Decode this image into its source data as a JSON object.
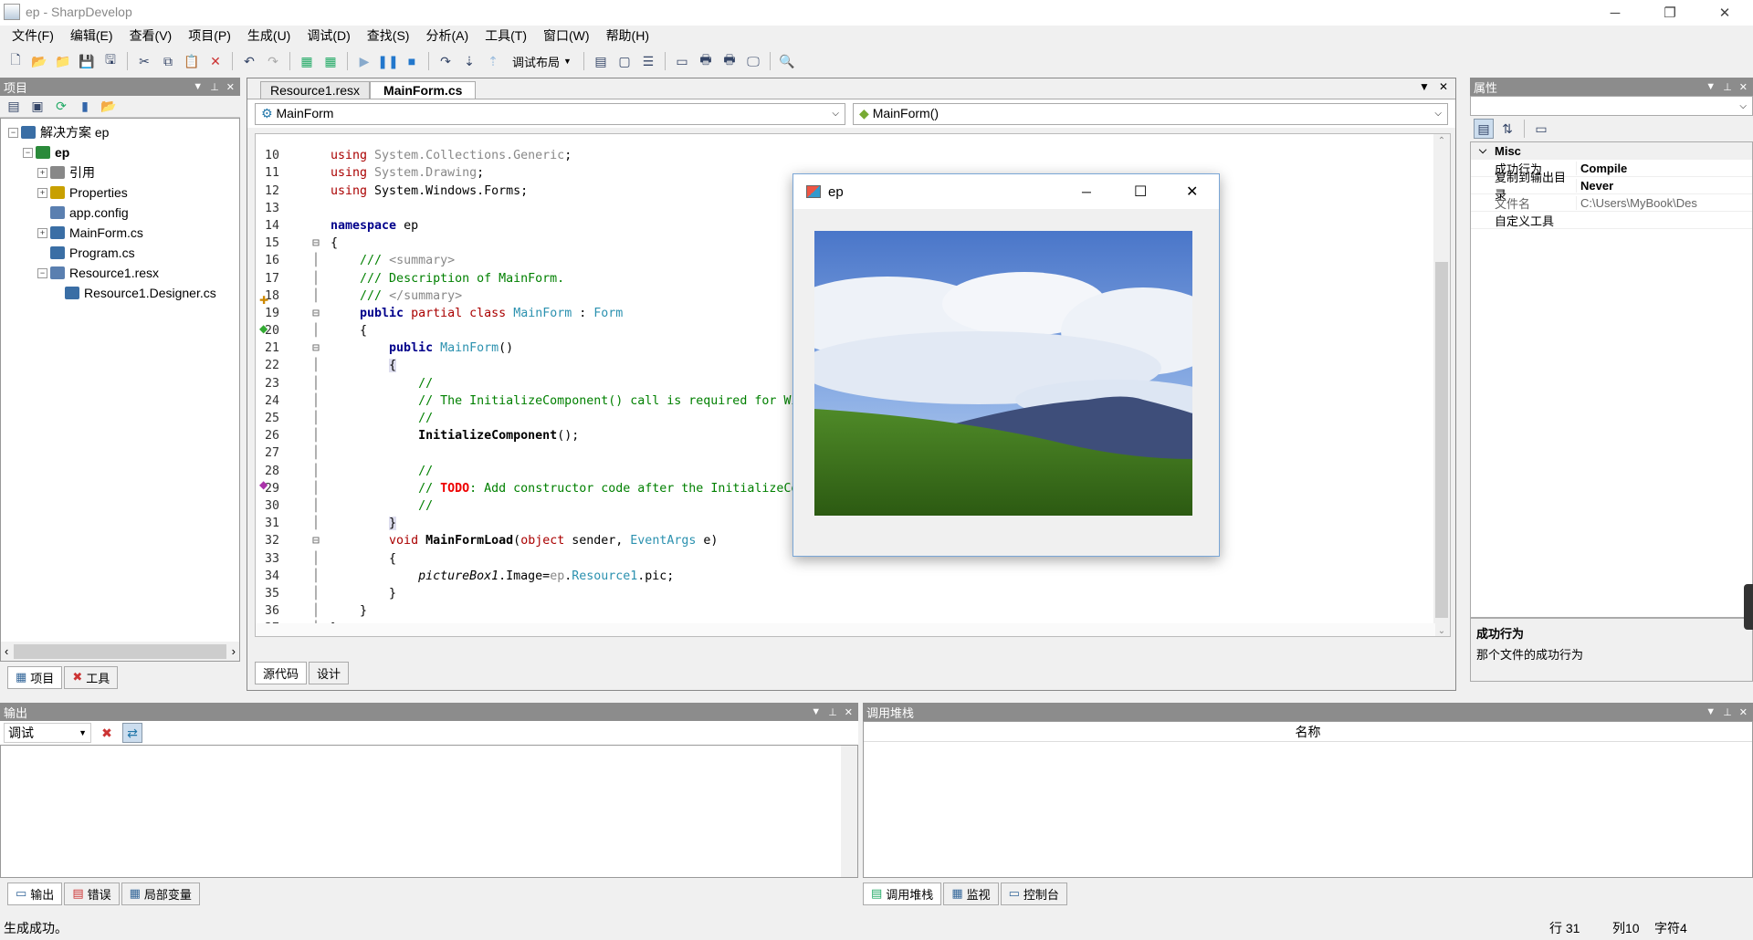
{
  "window": {
    "title": "ep - SharpDevelop",
    "min": "─",
    "max": "❐",
    "close": "✕"
  },
  "menu": [
    "文件(F)",
    "编辑(E)",
    "查看(V)",
    "项目(P)",
    "生成(U)",
    "调试(D)",
    "查找(S)",
    "分析(A)",
    "工具(T)",
    "窗口(W)",
    "帮助(H)"
  ],
  "toolbar": {
    "layout_label": "调试布局"
  },
  "project": {
    "title": "项目",
    "tree": [
      {
        "label": "解决方案 ep",
        "indent": 0,
        "exp": "−"
      },
      {
        "label": "ep",
        "indent": 1,
        "exp": "−",
        "bold": true
      },
      {
        "label": "引用",
        "indent": 2,
        "exp": "+"
      },
      {
        "label": "Properties",
        "indent": 2,
        "exp": "+"
      },
      {
        "label": "app.config",
        "indent": 2,
        "exp": ""
      },
      {
        "label": "MainForm.cs",
        "indent": 2,
        "exp": "+"
      },
      {
        "label": "Program.cs",
        "indent": 2,
        "exp": ""
      },
      {
        "label": "Resource1.resx",
        "indent": 2,
        "exp": "−"
      },
      {
        "label": "Resource1.Designer.cs",
        "indent": 3,
        "exp": ""
      }
    ],
    "tabs": [
      "项目",
      "工具"
    ]
  },
  "editor": {
    "tabs": [
      "Resource1.resx",
      "MainForm.cs"
    ],
    "class_combo": "MainForm",
    "member_combo": "MainForm()",
    "bottom_tabs": [
      "源代码",
      "设计"
    ]
  },
  "form_preview": {
    "title": "ep",
    "min": "─",
    "max": "☐",
    "close": "✕"
  },
  "properties": {
    "title": "属性",
    "category": "Misc",
    "rows": [
      {
        "k": "成功行为",
        "v": "Compile"
      },
      {
        "k": "复制到输出目录",
        "v": "Never"
      },
      {
        "k": "文件名",
        "v": "C:\\Users\\MyBook\\Des"
      },
      {
        "k": "自定义工具",
        "v": ""
      }
    ],
    "desc_title": "成功行为",
    "desc_text": "那个文件的成功行为"
  },
  "output": {
    "title": "输出",
    "combo": "调试",
    "tabs": [
      "输出",
      "错误",
      "局部变量"
    ]
  },
  "callstack": {
    "title": "调用堆栈",
    "col": "名称",
    "tabs": [
      "调用堆栈",
      "监视",
      "控制台"
    ]
  },
  "status": {
    "msg": "生成成功。",
    "row": "行 31",
    "col": "列10",
    "ch": "字符4"
  }
}
